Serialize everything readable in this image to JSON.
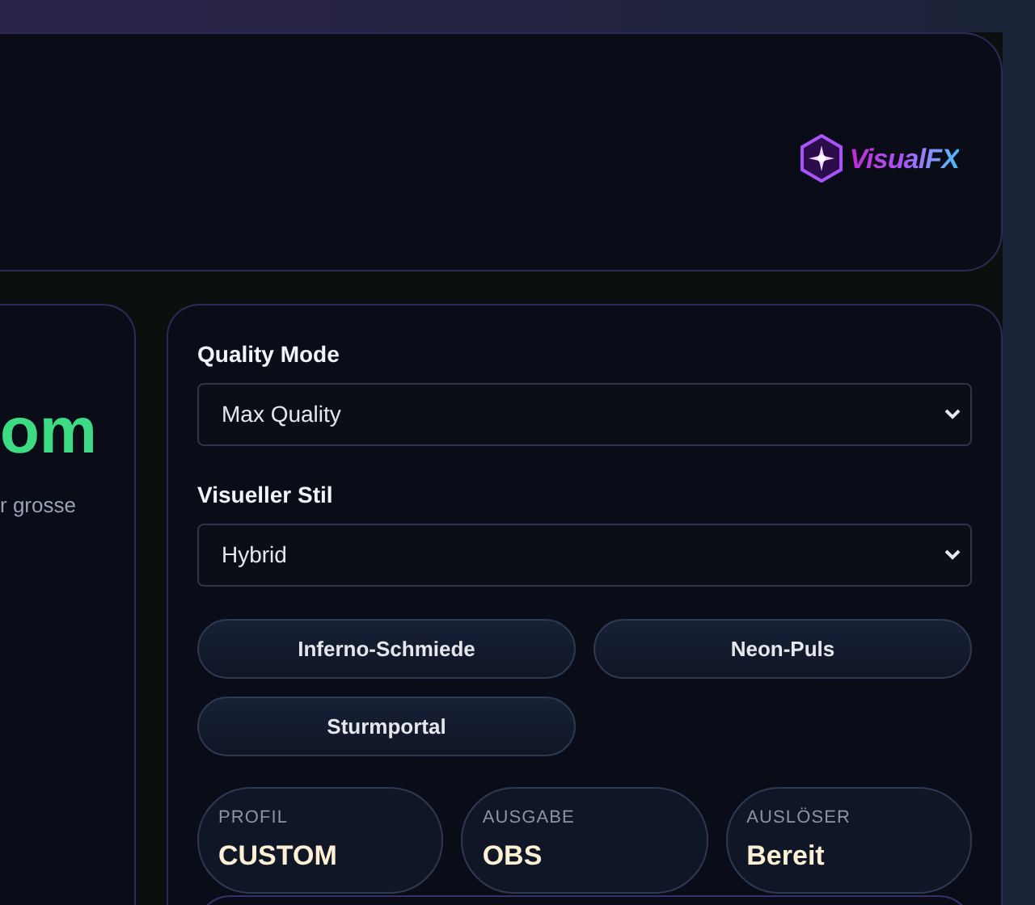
{
  "header": {
    "logo": {
      "text": "VisualFX"
    }
  },
  "left_card": {
    "headline": "om",
    "subtitle": "r grosse"
  },
  "settings": {
    "fields": [
      {
        "label": "Quality Mode",
        "value": "Max Quality"
      },
      {
        "label": "Visueller Stil",
        "value": "Hybrid"
      }
    ],
    "presets": [
      {
        "label": "Inferno-Schmiede"
      },
      {
        "label": "Neon-Puls"
      },
      {
        "label": "Sturmportal"
      }
    ],
    "stats": [
      {
        "label": "PROFIL",
        "value": "CUSTOM"
      },
      {
        "label": "AUSGABE",
        "value": "OBS"
      },
      {
        "label": "AUSLÖSER",
        "value": "Bereit"
      }
    ]
  }
}
